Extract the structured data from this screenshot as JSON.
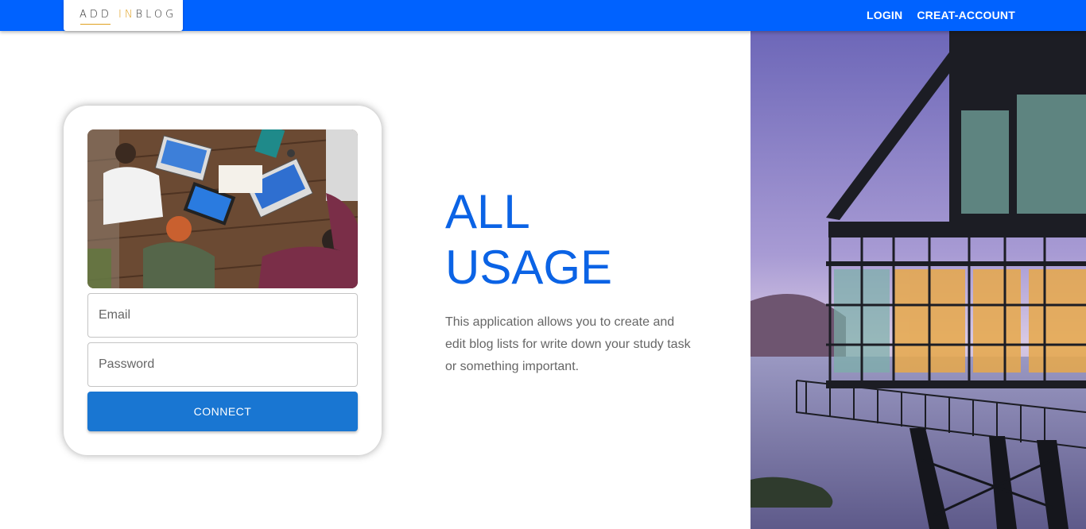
{
  "nav": {
    "logo_part1": "ADD ",
    "logo_part2": "IN",
    "logo_part3": "BLOG",
    "links": [
      "LOGIN",
      "CREAT-ACCOUNT"
    ]
  },
  "login_card": {
    "email_placeholder": "Email",
    "password_placeholder": "Password",
    "connect_label": "CONNECT"
  },
  "hero": {
    "title_line1": "ALL",
    "title_line2": "USAGE",
    "description": "This application allows you to create and edit blog lists for write down your study task or something important."
  },
  "colors": {
    "navbar": "#0062ff",
    "title": "#0b63e5",
    "button": "#1976d2",
    "logo_accent": "#e0a020"
  }
}
